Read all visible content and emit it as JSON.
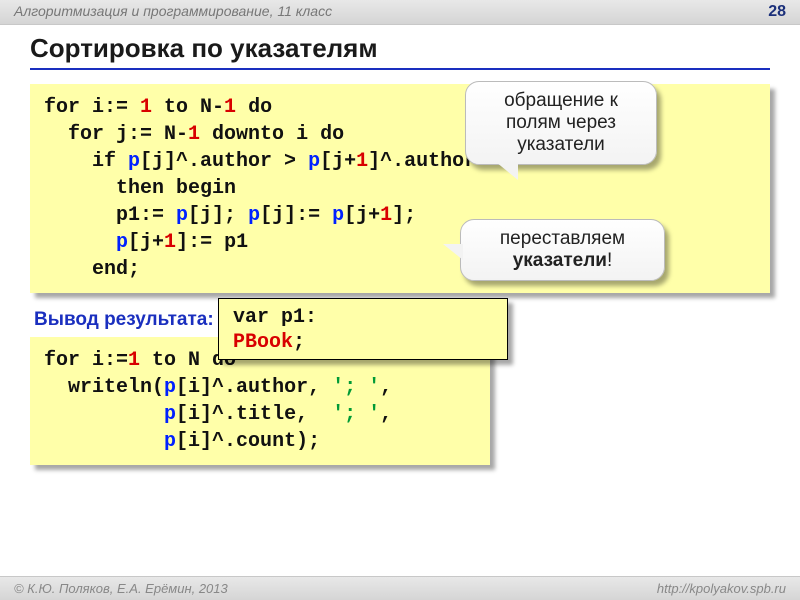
{
  "header": {
    "course": "Алгоритмизация и программирование, 11 класс",
    "page": "28"
  },
  "title": "Сортировка по указателям",
  "callouts": {
    "top": {
      "line1": "обращение к",
      "line2": "полям через",
      "line3": "указатели"
    },
    "middle": {
      "line1": "переставляем",
      "bold": "указатели",
      "bang": "!"
    }
  },
  "code1": {
    "l1": {
      "a": "for i:= ",
      "n1": "1",
      "b": " to N-",
      "n2": "1",
      "c": " do"
    },
    "l2": {
      "a": "  for j:= N-",
      "n1": "1",
      "b": " downto i do"
    },
    "l3": {
      "a": "    if ",
      "p1": "p",
      "b": "[j]^.author > ",
      "p2": "p",
      "c": "[j+",
      "n1": "1",
      "d": "]^.author"
    },
    "l4": "      then begin",
    "l5": {
      "a": "      p1:= ",
      "p1": "p",
      "b": "[j]; ",
      "p2": "p",
      "c": "[j]:= ",
      "p3": "p",
      "d": "[j+",
      "n1": "1",
      "e": "];"
    },
    "l6": {
      "a": "      ",
      "p1": "p",
      "b": "[j+",
      "n1": "1",
      "c": "]:= p1"
    },
    "l7": "    end;"
  },
  "varbox": {
    "a": "var ",
    "b": "      p1: ",
    "type": "PBook",
    "c": ";"
  },
  "subheading": "Вывод результата:",
  "code2": {
    "l1": {
      "a": "for i:=",
      "n1": "1",
      "b": " to N do"
    },
    "l2": {
      "a": "  writeln(",
      "p": "p",
      "b": "[i]^.author, ",
      "s": "'; '",
      "c": ","
    },
    "l3": {
      "a": "          ",
      "p": "p",
      "b": "[i]^.title,  ",
      "s": "'; '",
      "c": ","
    },
    "l4": {
      "a": "          ",
      "p": "p",
      "b": "[i]^.count);"
    }
  },
  "footer": {
    "left": "© К.Ю. Поляков, Е.А. Ерёмин, 2013",
    "right": "http://kpolyakov.spb.ru"
  }
}
